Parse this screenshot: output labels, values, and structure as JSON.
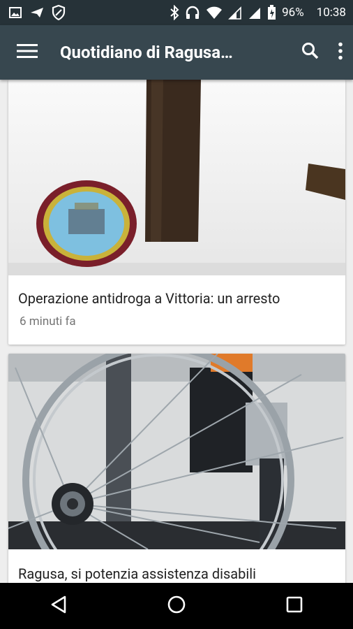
{
  "status_bar": {
    "battery": "96%",
    "time": "10:38",
    "left_icons": [
      "image-icon",
      "send-icon",
      "shield-icon"
    ],
    "right_icons": [
      "bluetooth-icon",
      "headphones-icon",
      "wifi-icon",
      "signal-icon",
      "signal-icon",
      "battery-icon"
    ]
  },
  "app_bar": {
    "title": "Quotidiano di Ragusa…",
    "menu_icon": "menu-icon",
    "search_icon": "search-icon",
    "more_icon": "more-vert-icon"
  },
  "articles": [
    {
      "headline": "Operazione antidroga a Vittoria: un arresto",
      "time": "6 minuti fa"
    },
    {
      "headline": "Ragusa, si potenzia assistenza disabili",
      "time": ""
    }
  ],
  "nav_bar": {
    "icons": [
      "back-icon",
      "home-icon",
      "recents-icon"
    ]
  },
  "colors": {
    "status_bar": "#263238",
    "app_bar": "#37474f",
    "background": "#eeeeee"
  }
}
